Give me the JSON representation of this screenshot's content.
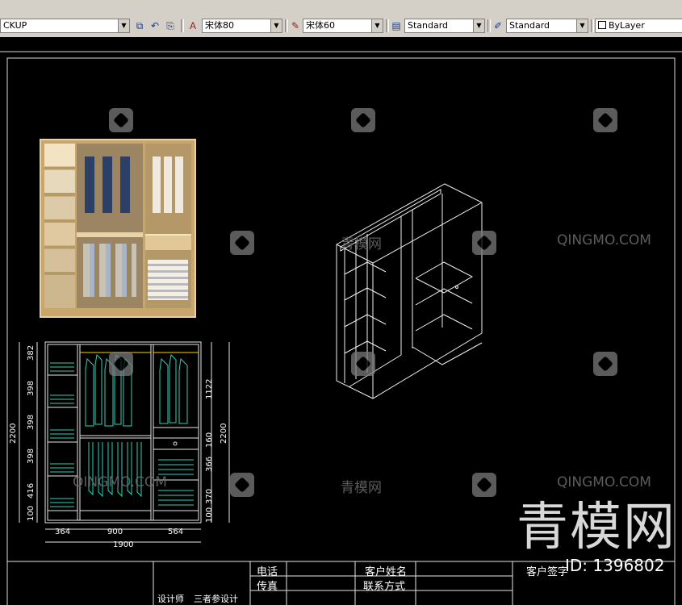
{
  "toolbar": {
    "layer_combo": "CKUP",
    "text_style_1": "宋体80",
    "text_style_2": "宋体60",
    "dim_style": "Standard",
    "table_style": "Standard",
    "color_combo": "ByLayer"
  },
  "drawing": {
    "watermark_en": "QINGMO.COM",
    "watermark_cn": "青模网",
    "brand": "青模网",
    "id_label": "ID: 1396802",
    "dims_left": [
      "382",
      "398",
      "398",
      "398",
      "416",
      "100"
    ],
    "dims_right": [
      "1122",
      "160",
      "366",
      "370",
      "100"
    ],
    "dim_total_height": "2200",
    "dims_bottom": [
      "364",
      "900",
      "564"
    ],
    "dim_total_width": "1900",
    "title_block": {
      "phone": "电话",
      "fax": "传真",
      "client_name": "客户姓名",
      "contact": "联系方式",
      "client_sign": "客户签字",
      "designer": "设计师",
      "project_note": "三者参设计"
    }
  }
}
